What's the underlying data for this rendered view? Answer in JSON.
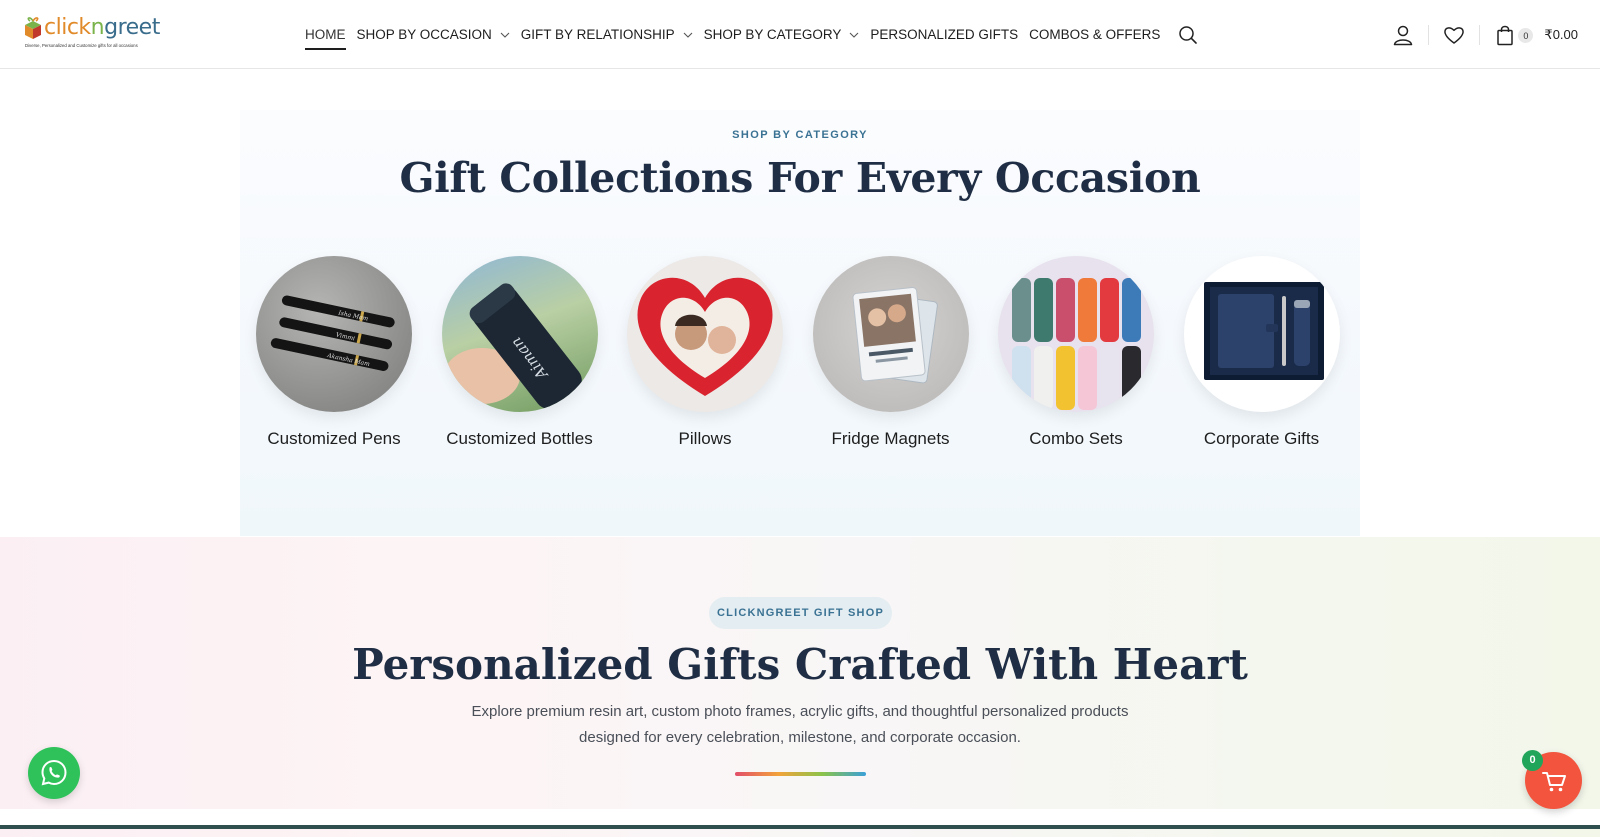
{
  "brand": {
    "name_part1": "click",
    "name_part2": "n",
    "name_part3": "greet",
    "tagline": "Diverse, Personalized and Customize gifts for all occasions",
    "colors": {
      "orange": "#e08a2a",
      "blue": "#3a6d8c",
      "green": "#7ab34a"
    }
  },
  "nav": {
    "items": [
      {
        "label": "HOME",
        "active": true,
        "dropdown": false
      },
      {
        "label": "SHOP BY OCCASION",
        "active": false,
        "dropdown": true
      },
      {
        "label": "GIFT BY RELATIONSHIP",
        "active": false,
        "dropdown": true
      },
      {
        "label": "SHOP BY CATEGORY",
        "active": false,
        "dropdown": true
      },
      {
        "label": "PERSONALIZED GIFTS",
        "active": false,
        "dropdown": false
      },
      {
        "label": "COMBOS & OFFERS",
        "active": false,
        "dropdown": false
      }
    ],
    "search_icon": "search-icon"
  },
  "header_right": {
    "account_icon": "user-icon",
    "wishlist_icon": "heart-icon",
    "cart_icon": "shopping-bag-icon",
    "cart_count": "0",
    "cart_total": "₹0.00"
  },
  "categories": {
    "eyebrow": "SHOP BY CATEGORY",
    "title": "Gift Collections For Every Occasion",
    "items": [
      {
        "label": "Customized Pens",
        "image_text": [
          "Isha Mam",
          "Vimmi",
          "Akansha Mam"
        ]
      },
      {
        "label": "Customized Bottles",
        "image_text": [
          "Aiman"
        ]
      },
      {
        "label": "Pillows"
      },
      {
        "label": "Fridge Magnets"
      },
      {
        "label": "Combo Sets"
      },
      {
        "label": "Corporate Gifts"
      }
    ]
  },
  "promo": {
    "pill": "CLICKNGREET GIFT SHOP",
    "title": "Personalized Gifts Crafted With Heart",
    "desc_line1": "Explore premium resin art, custom photo frames, acrylic gifts, and thoughtful personalized products",
    "desc_line2": "designed for every celebration, milestone, and corporate occasion."
  },
  "floating": {
    "whatsapp_icon": "whatsapp-icon",
    "cart_icon": "cart-icon",
    "cart_badge": "0",
    "whatsapp_color": "#2fc25b",
    "cart_color": "#f2543e"
  }
}
